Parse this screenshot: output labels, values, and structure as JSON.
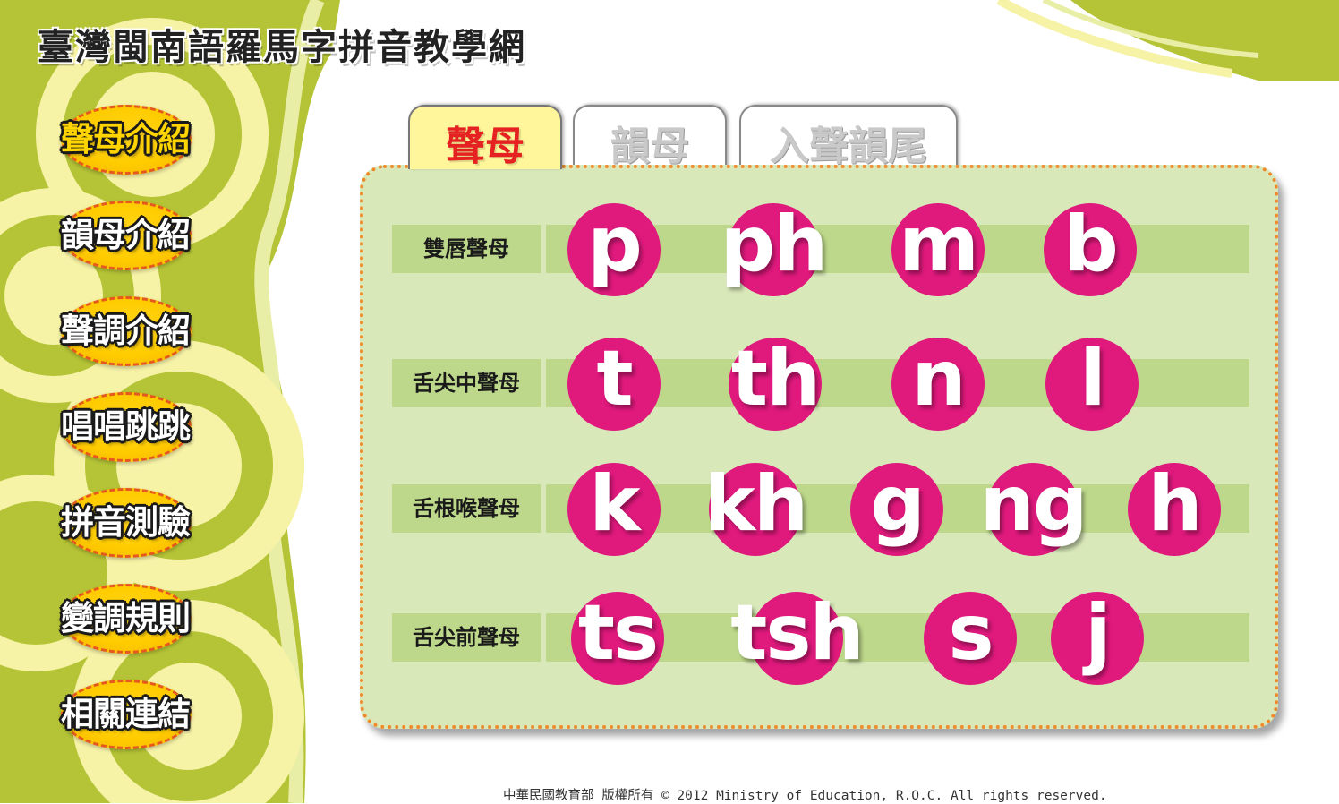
{
  "site_title": "臺灣閩南語羅馬字拼音教學網",
  "sidebar": {
    "items": [
      {
        "label": "聲母介紹"
      },
      {
        "label": "韻母介紹"
      },
      {
        "label": "聲調介紹"
      },
      {
        "label": "唱唱跳跳"
      },
      {
        "label": "拼音測驗"
      },
      {
        "label": "變調規則"
      },
      {
        "label": "相關連結"
      }
    ]
  },
  "tabs": [
    {
      "label": "聲母"
    },
    {
      "label": "韻母"
    },
    {
      "label": "入聲韻尾"
    }
  ],
  "groups": [
    {
      "label": "雙唇聲母",
      "letters": [
        "p",
        "ph",
        "m",
        "b"
      ]
    },
    {
      "label": "舌尖中聲母",
      "letters": [
        "t",
        "th",
        "n",
        "l"
      ]
    },
    {
      "label": "舌根喉聲母",
      "letters": [
        "k",
        "kh",
        "g",
        "ng",
        "h"
      ]
    },
    {
      "label": "舌尖前聲母",
      "letters": [
        "ts",
        "tsh",
        "s",
        "j"
      ]
    }
  ],
  "footer": {
    "text": "中華民國教育部 版權所有 © 2012 Ministry of Education, R.O.C. All rights reserved."
  },
  "colors": {
    "accent_magenta": "#e0197d",
    "panel_green": "#d8e8b9",
    "bar_green": "#bdd88a",
    "panel_border_orange": "#f08a2b",
    "menu_yellow": "#ffcc00",
    "background_olive": "#b5c436",
    "active_tab_yellow": "#fff59a",
    "active_tab_text_red": "#e52121"
  },
  "icons": {
    "letter_marker": "magenta-circle"
  }
}
